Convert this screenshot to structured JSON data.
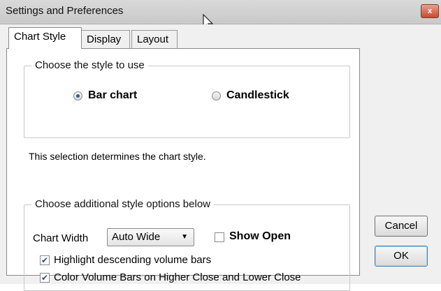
{
  "window": {
    "title": "Settings and Preferences",
    "close_glyph": "x"
  },
  "tabs": [
    {
      "label": "Chart Style",
      "active": true
    },
    {
      "label": "Display",
      "active": false
    },
    {
      "label": "Layout",
      "active": false
    }
  ],
  "style_group": {
    "legend": "Choose the style to use",
    "options": [
      {
        "label": "Bar chart",
        "checked": true
      },
      {
        "label": "Candlestick",
        "checked": false
      }
    ]
  },
  "description": "This selection determines the chart style.",
  "options_group": {
    "legend": "Choose additional style options below",
    "chart_width_label": "Chart Width",
    "chart_width_value": "Auto Wide",
    "show_open_label": "Show Open",
    "show_open_checked": false,
    "highlight_label": "Highlight descending volume bars",
    "highlight_checked": true,
    "color_volume_label": "Color Volume Bars on Higher Close and Lower Close",
    "color_volume_checked": true
  },
  "buttons": {
    "cancel": "Cancel",
    "ok": "OK"
  }
}
